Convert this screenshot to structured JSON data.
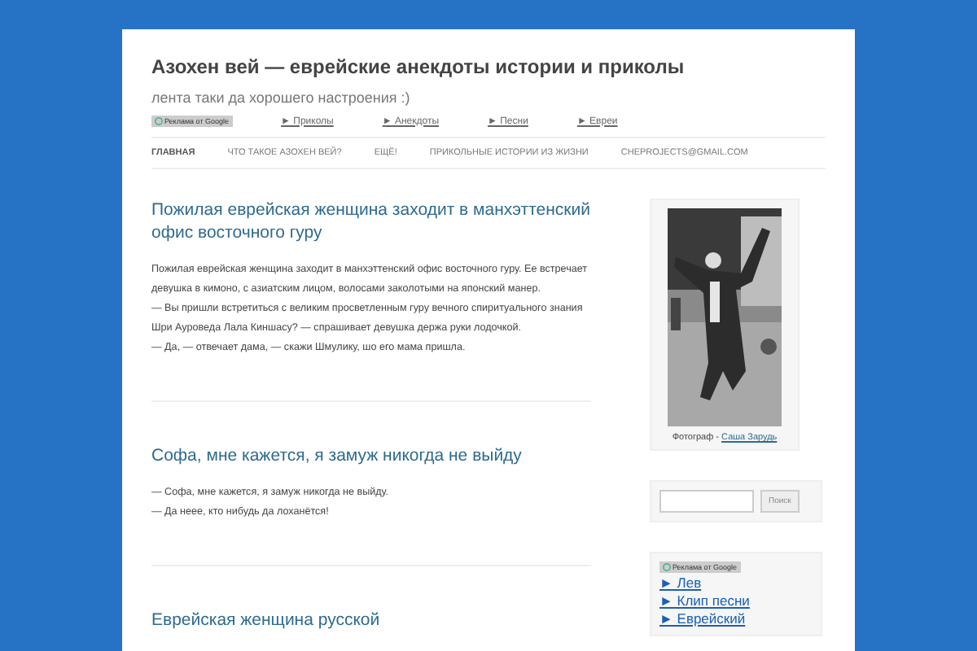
{
  "site": {
    "title": "Азохен вей — еврейские анекдоты истории и приколы",
    "tagline": "лента таки да хорошего настроения :)"
  },
  "ad_links": {
    "badge": "Реклама от Google",
    "links": [
      "► Приколы",
      "► Анекдоты",
      "► Песни",
      "► Евреи"
    ]
  },
  "nav": [
    {
      "label": "ГЛАВНАЯ",
      "selected": true
    },
    {
      "label": "ЧТО ТАКОЕ АЗОХЕН ВЕЙ?",
      "selected": false
    },
    {
      "label": "ЕЩЁ!",
      "selected": false
    },
    {
      "label": "ПРИКОЛЬНЫЕ ИСТОРИИ ИЗ ЖИЗНИ",
      "selected": false
    },
    {
      "label": "CHEPROJECTS@GMAIL.COM",
      "selected": false
    }
  ],
  "posts": [
    {
      "title": "Пожилая еврейская женщина заходит в манхэттенский офис восточного гуру",
      "paragraphs": [
        "Пожилая еврейская женщина заходит в манхэттенский офис восточного гуру. Ее встречает девушка в кимоно, с азиатским лицом, волосами заколотыми на японский манер.",
        "— Вы пришли встретиться с великим просветленным гуру вечного спиритуального знания Шри Ауроведа Лала Киншасу? — спрашивает девушка держа руки лодочкой.",
        "— Да, — отвечает дама, — скажи Шмулику, шо его мама пришла."
      ]
    },
    {
      "title": "Софа, мне кажется, я замуж никогда не выйду",
      "paragraphs": [
        "— Софа, мне кажется, я замуж никогда не выйду.",
        "— Да нееe, кто нибудь да лоханётся!"
      ]
    },
    {
      "title": "Еврейская женщина русской"
    }
  ],
  "sidebar": {
    "photo": {
      "kind": "picture",
      "caption": "Фотограф - ",
      "author": "Саша Зарудь"
    },
    "search": {
      "button": "Поиск"
    },
    "ads": {
      "badge": "Реклама от Google",
      "links": [
        "► Лев",
        "► Клип песни",
        "► Еврейский"
      ]
    }
  }
}
